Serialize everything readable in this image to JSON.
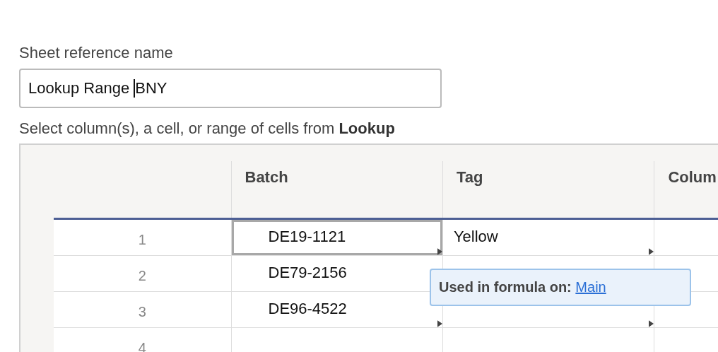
{
  "name_label": "Sheet reference name",
  "name_field": {
    "value_before_caret": "Lookup Range ",
    "value_after_caret": "BNY"
  },
  "helper_text": "Select column(s), a cell, or range of cells from **Lookup**",
  "table": {
    "columns": [
      "Batch",
      "Tag",
      "Colum"
    ],
    "rows": [
      {
        "number": "1",
        "cells": [
          {
            "text": "DE19-1121",
            "selected": true,
            "marker": true
          },
          {
            "text": "Yellow",
            "selected": false,
            "marker": true
          }
        ]
      },
      {
        "number": "2",
        "cells": [
          {
            "text": "DE79-2156",
            "selected": false,
            "marker": false
          }
        ]
      },
      {
        "number": "3",
        "cells": [
          {
            "text": "DE96-4522",
            "selected": false,
            "marker": true
          },
          {
            "marker": true
          }
        ]
      },
      {
        "number": "4"
      }
    ]
  },
  "tooltip": {
    "label": "Used in formula on:",
    "link": "Main"
  }
}
